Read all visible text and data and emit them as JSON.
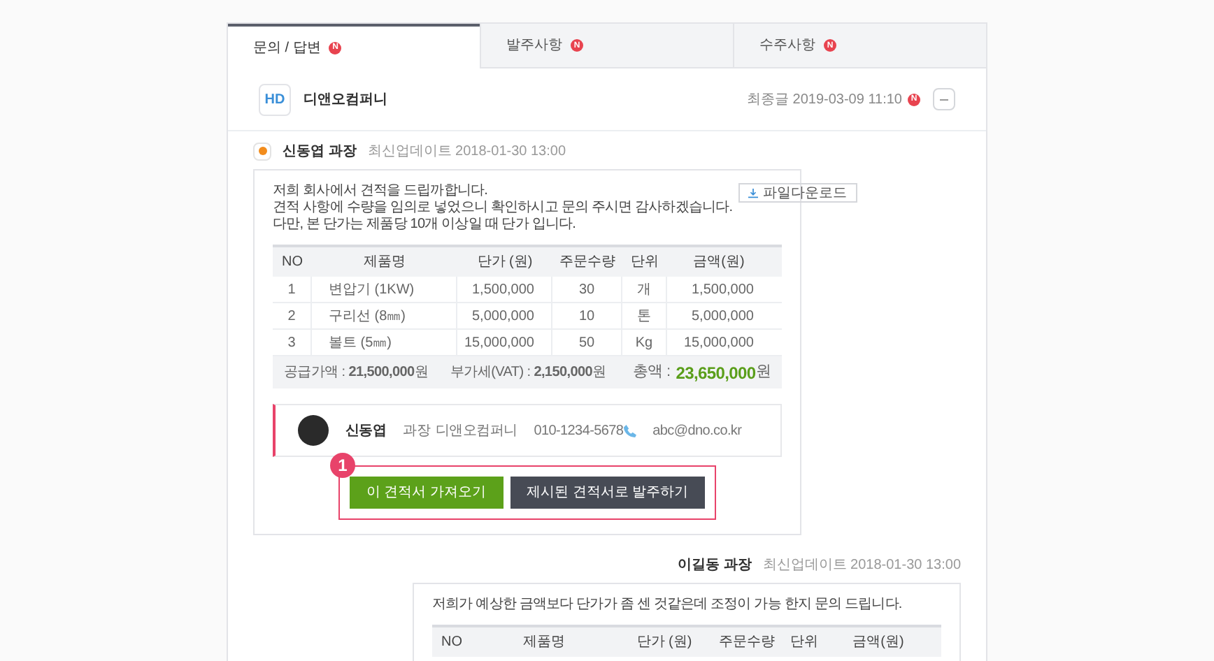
{
  "tabs": [
    {
      "label": "문의 / 답변",
      "selected": true,
      "badge": "N"
    },
    {
      "label": "발주사항",
      "selected": false,
      "badge": "N"
    },
    {
      "label": "수주사항",
      "selected": false,
      "badge": "N"
    }
  ],
  "company": {
    "logo": "HD",
    "name": "디앤오컴퍼니",
    "last_post": "최종글 2019-03-09 11:10",
    "badge": "N"
  },
  "messages": [
    {
      "kind": "received",
      "author": "신동엽 과장",
      "updated": "최신업데이트 2018-01-30 13:00",
      "download": "파일다운로드",
      "lines": [
        "저희 회사에서 견적을 드립까합니다.",
        "견적 사항에 수량을 임의로 넣었으니 확인하시고 문의 주시면 감사하겠습니다.",
        "다만, 본 단가는 제품당 10개 이상일 때 단가 입니다."
      ],
      "table": {
        "columns": [
          "NO",
          "제품명",
          "단가 (원)",
          "주문수량",
          "단위",
          "금액(원)"
        ],
        "rows": [
          [
            "1",
            "변압기 (1KW)",
            "1,500,000",
            "30",
            "개",
            "1,500,000"
          ],
          [
            "2",
            "구리선 (8㎜)",
            "5,000,000",
            "10",
            "톤",
            "5,000,000"
          ],
          [
            "3",
            "볼트 (5㎜)",
            "15,000,000",
            "50",
            "Kg",
            "15,000,000"
          ]
        ],
        "supply": "공급가액 : **21,500,000**원",
        "vat": "부가세(VAT) : **2,150,000**원",
        "total_label": "총액 :",
        "total": "23,650,000",
        "total_unit": "원"
      },
      "contact": {
        "name": "신동엽",
        "title": "과장",
        "company": "디앤오컴퍼니",
        "phone": "010-1234-5678",
        "email": "abc@dno.co.kr"
      },
      "marker": "1",
      "buttons": [
        {
          "label": "이 견적서 가져오기",
          "kind": "primary"
        },
        {
          "label": "제시된 견적서로 발주하기",
          "kind": "dark"
        }
      ]
    },
    {
      "kind": "sent",
      "author": "이길동 과장",
      "updated": "최신업데이트 2018-01-30 13:00",
      "lines": [
        "저희가 예상한 금액보다 단가가 좀 센 것같은데 조정이 가능 한지 문의 드립니다."
      ],
      "table": {
        "columns": [
          "NO",
          "제품명",
          "단가 (원)",
          "주문수량",
          "단위",
          "금액(원)"
        ]
      }
    }
  ]
}
